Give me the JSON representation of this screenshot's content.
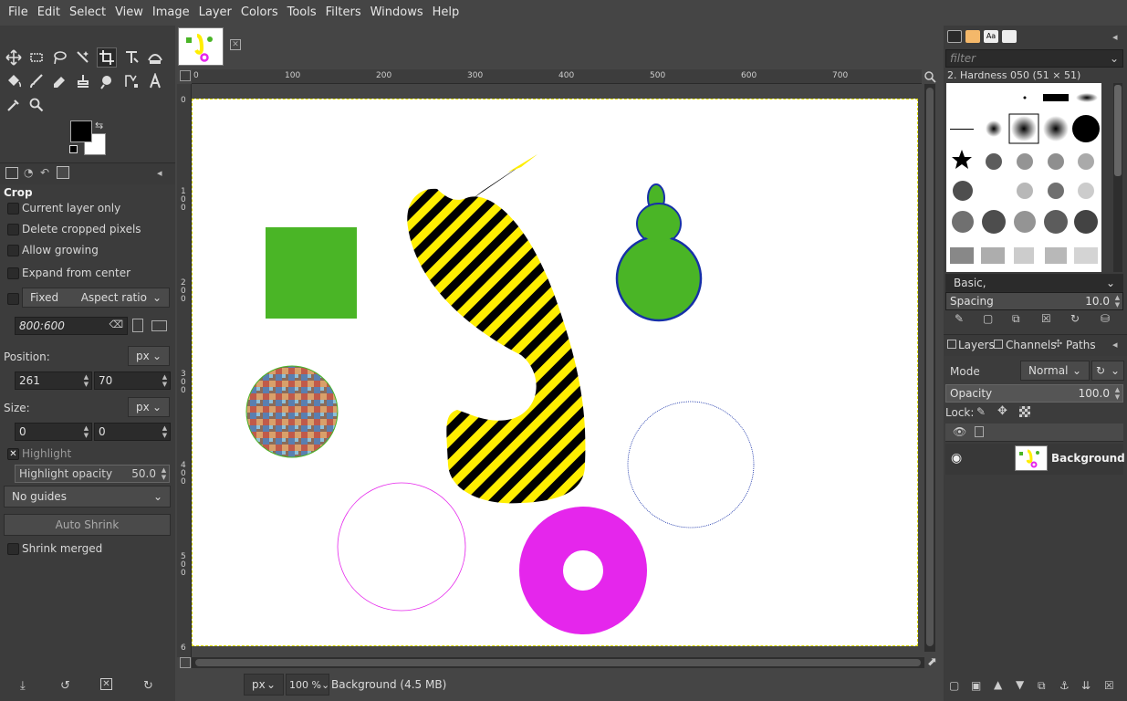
{
  "menubar": {
    "items": [
      "File",
      "Edit",
      "Select",
      "View",
      "Image",
      "Layer",
      "Colors",
      "Tools",
      "Filters",
      "Windows",
      "Help"
    ]
  },
  "tool_options": {
    "title": "Crop",
    "current_layer_only": "Current layer only",
    "delete_cropped_pixels": "Delete cropped pixels",
    "allow_growing": "Allow growing",
    "expand_from_center": "Expand from center",
    "fixed_label": "Fixed",
    "fixed_mode": "Aspect ratio",
    "ratio_value": "800:600",
    "position_label": "Position:",
    "position_unit": "px",
    "position_x": "261",
    "position_y": "70",
    "size_label": "Size:",
    "size_unit": "px",
    "size_w": "0",
    "size_h": "0",
    "highlight": "Highlight",
    "highlight_opacity_label": "Highlight opacity",
    "highlight_opacity_value": "50.0",
    "guides": "No guides",
    "auto_shrink": "Auto Shrink",
    "shrink_merged": "Shrink merged"
  },
  "ruler_h": [
    "0",
    "100",
    "200",
    "300",
    "400",
    "500",
    "600",
    "700"
  ],
  "ruler_v": [
    "0",
    "1 0 0",
    "2 0 0",
    "3 0 0",
    "4 0 0",
    "5 0 0",
    "6"
  ],
  "statusbar": {
    "unit": "px",
    "zoom": "100 %",
    "info": "Background (4.5 MB)"
  },
  "brushes": {
    "filter_placeholder": "filter",
    "current_brush": "2. Hardness 050 (51 × 51)",
    "tag": "Basic,",
    "spacing_label": "Spacing",
    "spacing_value": "10.0"
  },
  "layers": {
    "tabs": [
      "Layers",
      "Channels",
      "Paths"
    ],
    "mode_label": "Mode",
    "mode_value": "Normal",
    "opacity_label": "Opacity",
    "opacity_value": "100.0",
    "lock_label": "Lock:",
    "layer_name": "Background"
  },
  "colors": {
    "green": "#4ab526",
    "magenta": "#e526ec",
    "yellow": "#ffee00",
    "blue_outline": "#1630a8"
  }
}
